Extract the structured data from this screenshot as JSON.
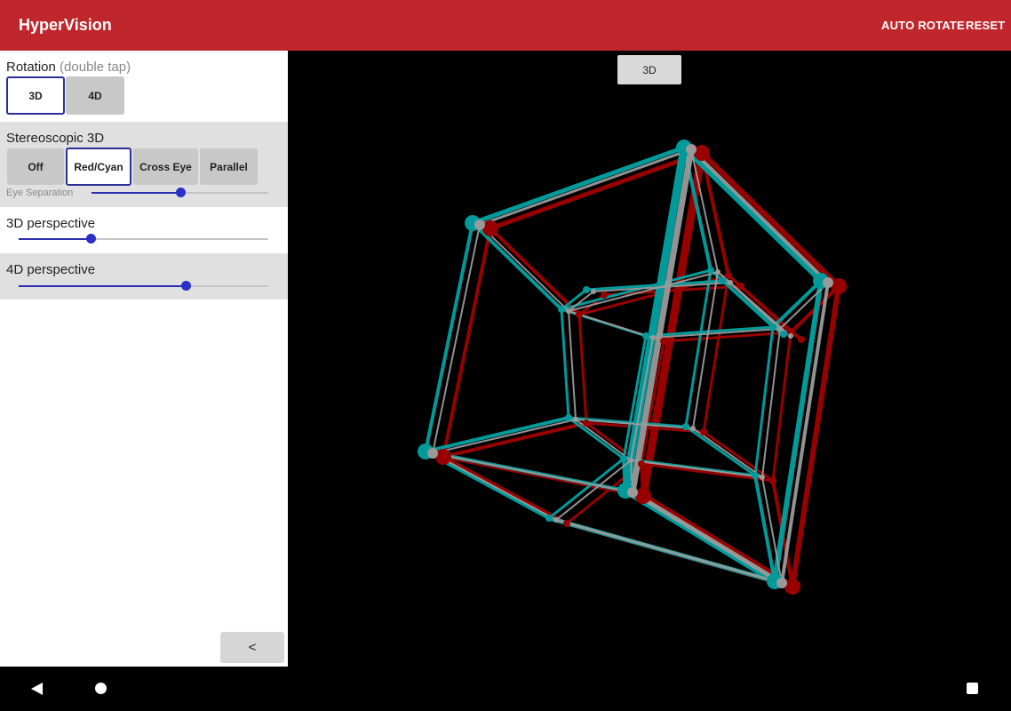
{
  "app": {
    "title": "HyperVision"
  },
  "actions": {
    "auto_rotate": "AUTO ROTATE",
    "reset": "RESET"
  },
  "panel": {
    "rotation": {
      "title": "Rotation",
      "hint": "(double tap)",
      "options": [
        "3D",
        "4D"
      ],
      "selected": "3D"
    },
    "stereo": {
      "title": "Stereoscopic 3D",
      "options": [
        "Off",
        "Red/Cyan",
        "Cross Eye",
        "Parallel"
      ],
      "selected": "Red/Cyan",
      "eye_separation_label": "Eye Separation",
      "eye_separation_value": 0.5
    },
    "perspective_3d": {
      "title": "3D perspective",
      "value": 0.29
    },
    "perspective_4d": {
      "title": "4D perspective",
      "value": 0.67
    },
    "collapse_label": "<"
  },
  "viewport": {
    "mode_label": "3D",
    "colors": {
      "red": "#990000",
      "cyan": "#009a9a",
      "overlap": "#9a9a9a",
      "background": "#000000"
    }
  }
}
